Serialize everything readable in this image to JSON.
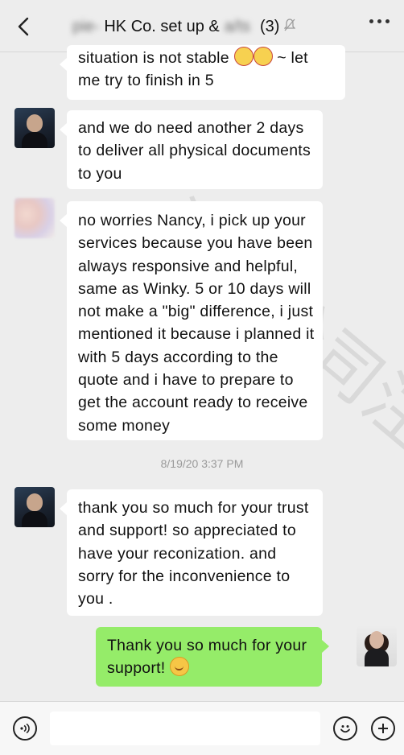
{
  "header": {
    "title_blurred": "pie-",
    "title_visible": "HK Co. set up &",
    "title_blurred2": "a/ts",
    "member_count": "(3)"
  },
  "timestamp": "8/19/20 3:37 PM",
  "watermark_text": "深港公司注册",
  "messages": [
    {
      "id": "m1",
      "side": "left",
      "lines": [
        "situation is not stable",
        "me try to finish in 5"
      ],
      "emoji_tail_text": "~ let"
    },
    {
      "id": "m2",
      "side": "left",
      "lines": [
        "and we do need another 2 days",
        "to deliver all physical documents",
        "to you"
      ]
    },
    {
      "id": "m3",
      "side": "left",
      "lines": [
        "no worries Nancy, i pick up your",
        "services because you have been",
        "always responsive and helpful,",
        "same as Winky. 5 or 10 days will",
        "not make a \"big\" difference, i just",
        "mentioned it because i planned it",
        "with 5 days according to the",
        "quote and i have to prepare to",
        "get the account ready to receive",
        "some money"
      ]
    },
    {
      "id": "m4",
      "side": "left",
      "lines": [
        "thank you so much for your trust",
        "and support! so appreciated to",
        "have your reconization.  and",
        "sorry for the inconvenience to",
        "you ."
      ]
    },
    {
      "id": "m5",
      "side": "right",
      "lines": [
        "Thank you so much for your",
        "support!"
      ]
    }
  ],
  "icons": {
    "back": "chevron-left",
    "mute": "bell-muted",
    "more": "ellipsis",
    "voice": "voice-wave",
    "emoji": "smiley-face",
    "plus": "plus"
  },
  "colors": {
    "background": "#ededed",
    "bubble_incoming": "#ffffff",
    "bubble_outgoing": "#95ec69"
  }
}
